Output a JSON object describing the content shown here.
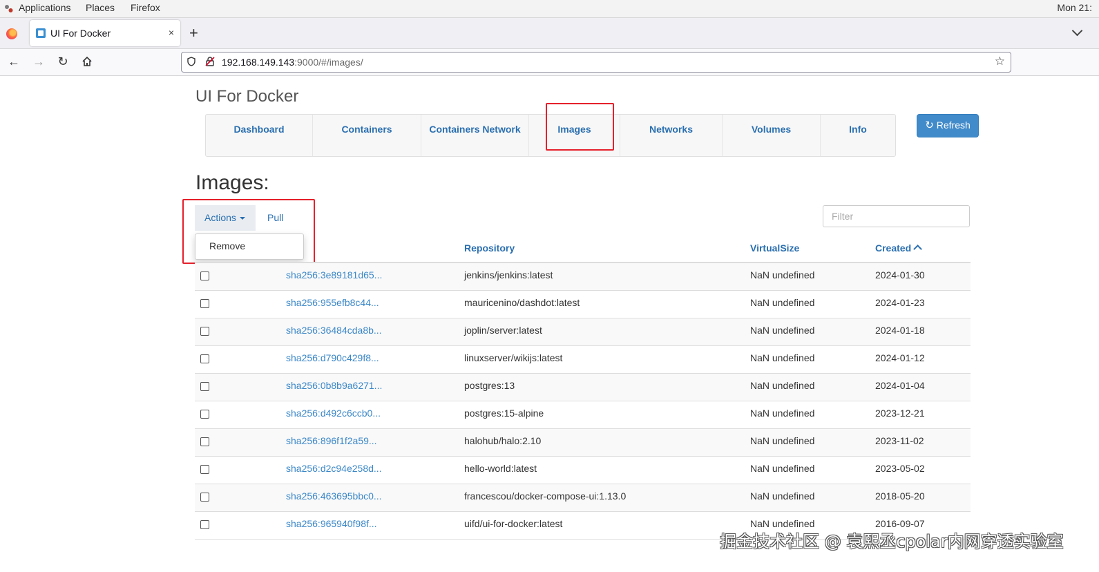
{
  "system_bar": {
    "menus": [
      "Applications",
      "Places",
      "Firefox"
    ],
    "clock": "Mon 21:"
  },
  "browser": {
    "tab_title": "UI For Docker",
    "tab_close": "×",
    "new_tab": "+",
    "url_host": "192.168.149.143",
    "url_rest": ":9000/#/images/"
  },
  "app": {
    "title": "UI For Docker",
    "nav": [
      {
        "label": "Dashboard"
      },
      {
        "label": "Containers"
      },
      {
        "label": "Containers Network"
      },
      {
        "label": "Images",
        "active": true
      },
      {
        "label": "Networks"
      },
      {
        "label": "Volumes"
      },
      {
        "label": "Info"
      }
    ],
    "refresh_label": "Refresh",
    "highlight_color": "#e5202b",
    "accent_color": "#428bca"
  },
  "images": {
    "heading": "Images:",
    "actions_label": "Actions",
    "pull_label": "Pull",
    "dropdown_items": [
      "Remove"
    ],
    "filter_placeholder": "Filter",
    "columns": [
      "Repository",
      "VirtualSize",
      "Created"
    ],
    "sort_column": "Created",
    "sort_direction": "ascending-indicator",
    "rows": [
      {
        "id": "sha256:3e89181d65...",
        "repository": "jenkins/jenkins:latest",
        "virtual_size": "NaN undefined",
        "created": "2024-01-30"
      },
      {
        "id": "sha256:955efb8c44...",
        "repository": "mauricenino/dashdot:latest",
        "virtual_size": "NaN undefined",
        "created": "2024-01-23"
      },
      {
        "id": "sha256:36484cda8b...",
        "repository": "joplin/server:latest",
        "virtual_size": "NaN undefined",
        "created": "2024-01-18"
      },
      {
        "id": "sha256:d790c429f8...",
        "repository": "linuxserver/wikijs:latest",
        "virtual_size": "NaN undefined",
        "created": "2024-01-12"
      },
      {
        "id": "sha256:0b8b9a6271...",
        "repository": "postgres:13",
        "virtual_size": "NaN undefined",
        "created": "2024-01-04"
      },
      {
        "id": "sha256:d492c6ccb0...",
        "repository": "postgres:15-alpine",
        "virtual_size": "NaN undefined",
        "created": "2023-12-21"
      },
      {
        "id": "sha256:896f1f2a59...",
        "repository": "halohub/halo:2.10",
        "virtual_size": "NaN undefined",
        "created": "2023-11-02"
      },
      {
        "id": "sha256:d2c94e258d...",
        "repository": "hello-world:latest",
        "virtual_size": "NaN undefined",
        "created": "2023-05-02"
      },
      {
        "id": "sha256:463695bbc0...",
        "repository": "francescou/docker-compose-ui:1.13.0",
        "virtual_size": "NaN undefined",
        "created": "2018-05-20"
      },
      {
        "id": "sha256:965940f98f...",
        "repository": "uifd/ui-for-docker:latest",
        "virtual_size": "NaN undefined",
        "created": "2016-09-07"
      }
    ]
  },
  "watermark": "掘金技术社区 @ 袁熙丞cpolar内网穿透实验室"
}
